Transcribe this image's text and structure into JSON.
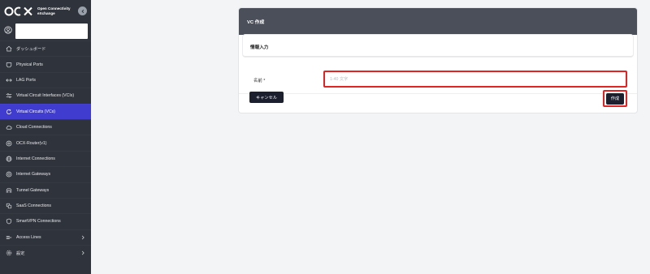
{
  "brand": {
    "logo_text": "OCX",
    "line1": "Open Connectivity",
    "line2": "eXchange"
  },
  "sidebar": {
    "items": [
      {
        "label": "ダッシュボード",
        "icon": "home-icon"
      },
      {
        "label": "Physical Ports",
        "icon": "port-icon"
      },
      {
        "label": "LAG Ports",
        "icon": "lag-icon"
      },
      {
        "label": "Virtual Circuit Interfaces (VCIs)",
        "icon": "sliders-icon"
      },
      {
        "label": "Virtual Circuits (VCs)",
        "icon": "refresh-icon",
        "active": true
      },
      {
        "label": "Cloud Connections",
        "icon": "cloud-icon"
      },
      {
        "label": "OCX-Router(v1)",
        "icon": "router-icon"
      },
      {
        "label": "Internet Connections",
        "icon": "globe-icon"
      },
      {
        "label": "Internet Gateways",
        "icon": "gateway-icon"
      },
      {
        "label": "Tunnel Gateways",
        "icon": "tunnel-icon"
      },
      {
        "label": "SaaS Connections",
        "icon": "saas-icon"
      },
      {
        "label": "SmartVPN Connections",
        "icon": "vpn-icon"
      },
      {
        "label": "Access Lines",
        "icon": "access-lines-icon",
        "chevron": true
      },
      {
        "label": "設定",
        "icon": "gear-icon",
        "chevron": true
      }
    ]
  },
  "page": {
    "title": "VC 作成",
    "section_title": "情報入力",
    "name_label": "名前 *",
    "name_placeholder": "1-40 文字",
    "name_value": "",
    "cancel_label": "キャンセル",
    "create_label": "作成"
  },
  "colors": {
    "sidebar_bg": "#2f333b",
    "active_item": "#3f3ccf",
    "header_bg": "#4b4f59",
    "button_bg": "#1b1f2e",
    "highlight": "#e02424"
  }
}
